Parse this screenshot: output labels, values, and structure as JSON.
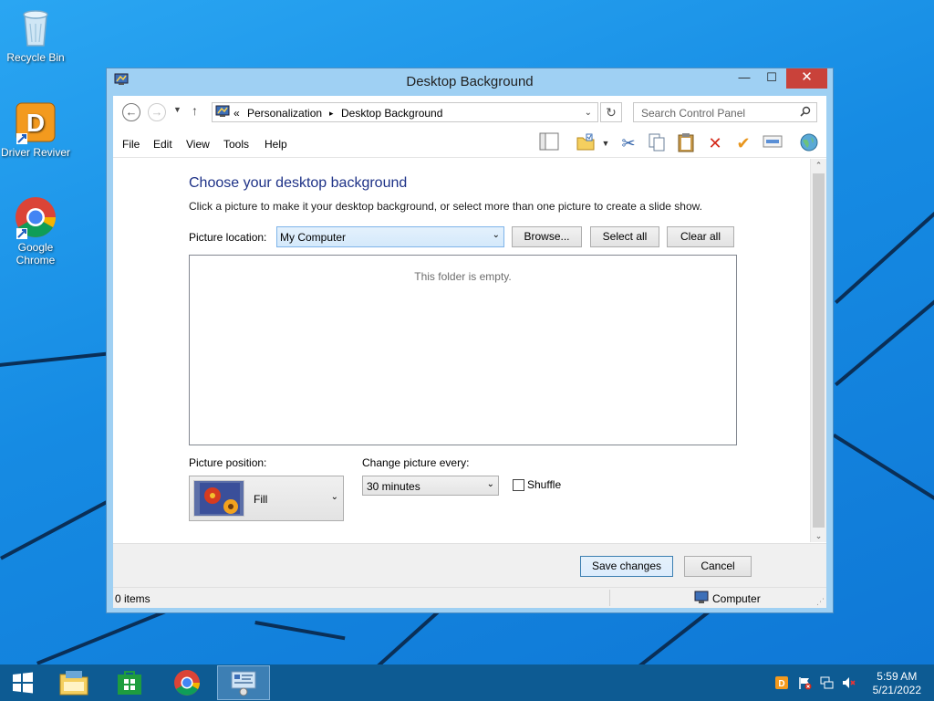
{
  "desktop": {
    "icons": [
      {
        "label": "Recycle Bin",
        "icon": "recycle-bin-icon"
      },
      {
        "label": "Driver Reviver",
        "icon": "driver-reviver-icon"
      },
      {
        "label": "Google Chrome",
        "icon": "chrome-icon"
      }
    ]
  },
  "window": {
    "title": "Desktop Background",
    "controls": {
      "minimize": "—",
      "maximize": "☐",
      "close": "✕"
    }
  },
  "address_bar": {
    "prefix": "«",
    "crumbs": [
      "Personalization",
      "Desktop Background"
    ],
    "separator": "▸",
    "search_placeholder": "Search Control Panel"
  },
  "menu": [
    "File",
    "Edit",
    "View",
    "Tools",
    "Help"
  ],
  "content": {
    "heading": "Choose your desktop background",
    "instructions": "Click a picture to make it your desktop background, or select more than one picture to create a slide show.",
    "picture_location_label": "Picture location:",
    "picture_location_value": "My Computer",
    "browse_label": "Browse...",
    "select_all_label": "Select all",
    "clear_all_label": "Clear all",
    "empty_message": "This folder is empty.",
    "picture_position_label": "Picture position:",
    "picture_position_value": "Fill",
    "change_picture_label": "Change picture every:",
    "change_picture_value": "30 minutes",
    "shuffle_label": "Shuffle",
    "shuffle_checked": false
  },
  "footer": {
    "save_label": "Save changes",
    "cancel_label": "Cancel"
  },
  "status": {
    "items": "0 items",
    "location": "Computer"
  },
  "taskbar": {
    "time": "5:59 AM",
    "date": "5/21/2022"
  },
  "colors": {
    "accent_heading": "#1e3287",
    "window_frame": "#9fd0f3",
    "close_button": "#c9423a",
    "taskbar": "#0d5b93"
  }
}
